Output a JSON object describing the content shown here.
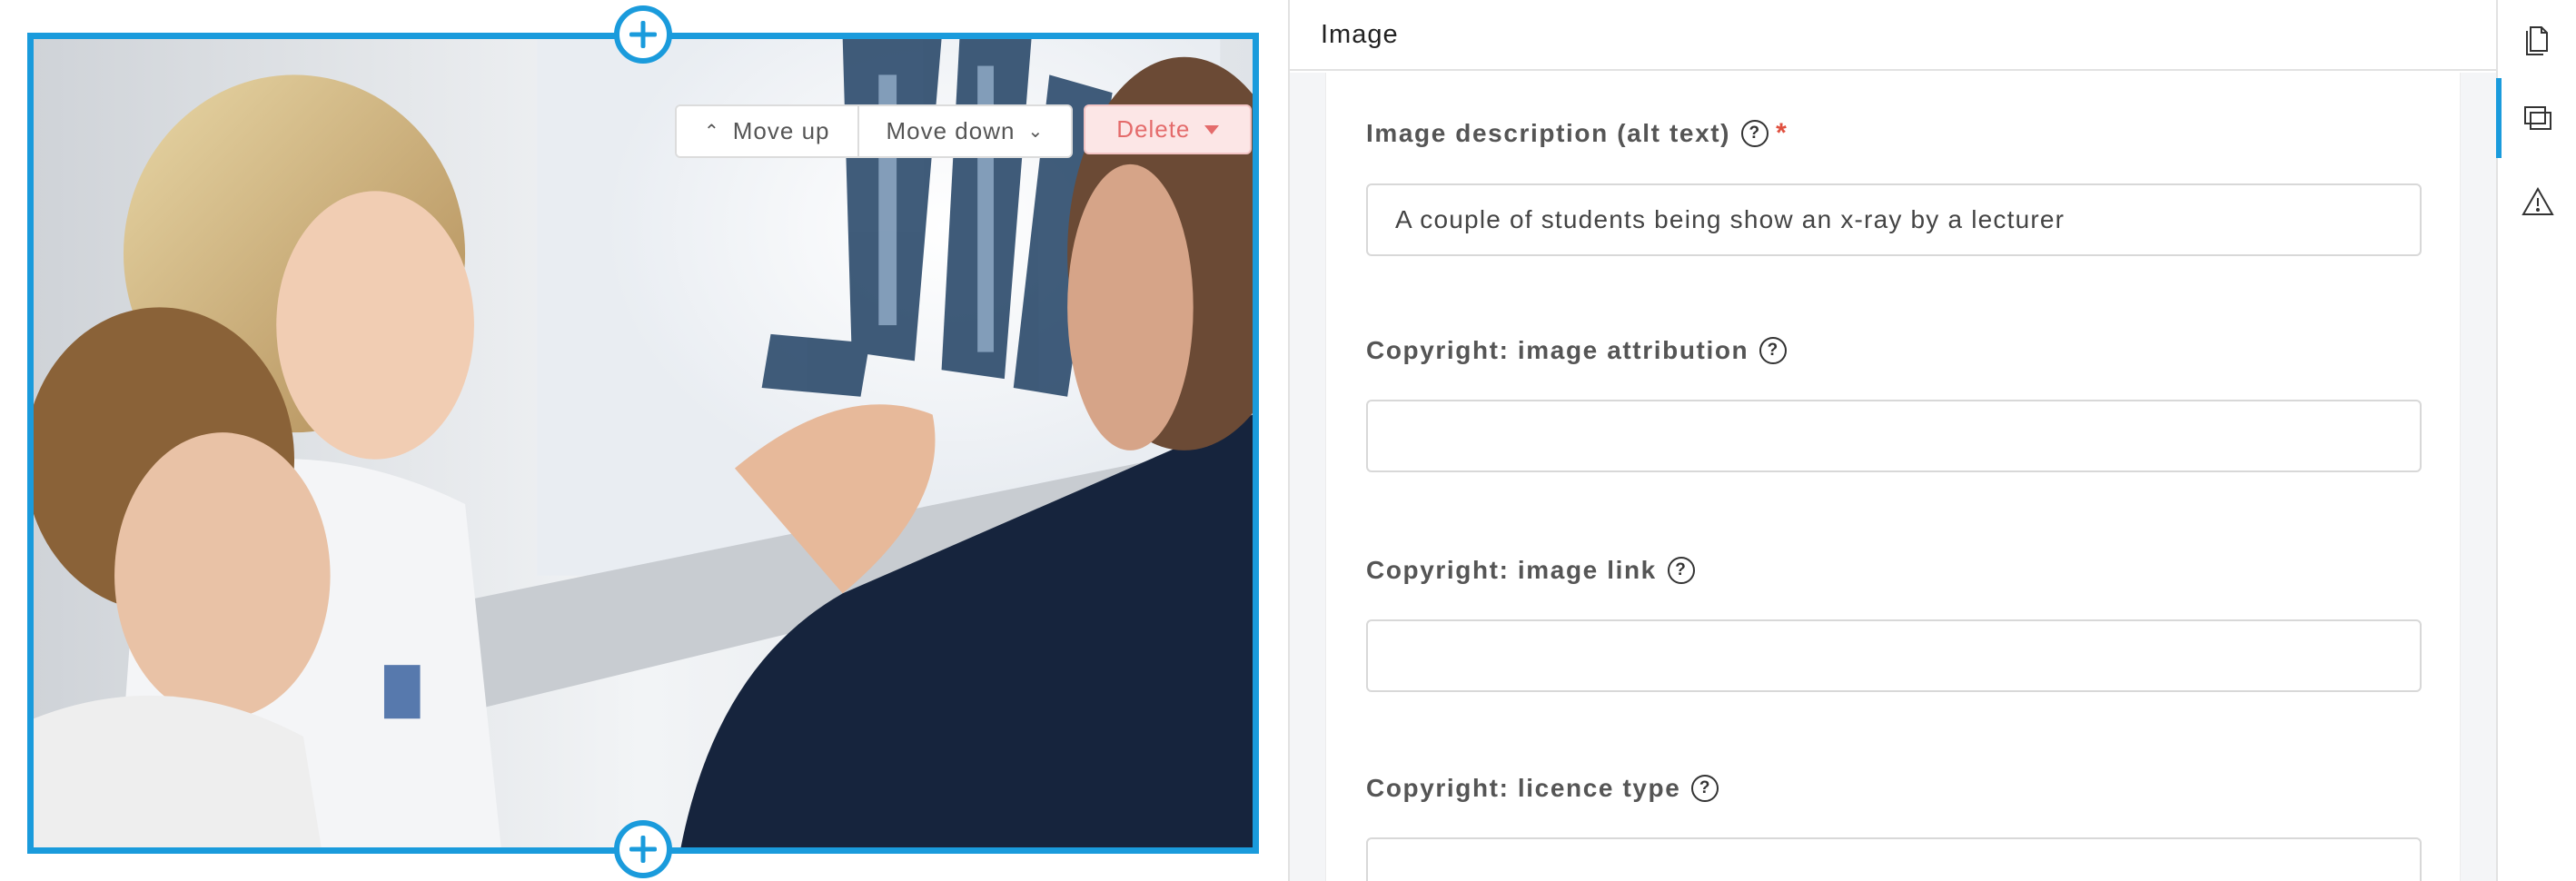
{
  "editor": {
    "toolbar": {
      "move_up": "Move up",
      "move_down": "Move down",
      "delete": "Delete"
    }
  },
  "panel": {
    "title": "Image",
    "fields": {
      "alt": {
        "label": "Image description (alt text)",
        "value": "A couple of students being show an x-ray by a  lecturer",
        "required": true
      },
      "attribution": {
        "label": "Copyright: image attribution",
        "value": ""
      },
      "link": {
        "label": "Copyright: image link",
        "value": ""
      },
      "licence": {
        "label": "Copyright: licence type",
        "value": ""
      }
    }
  },
  "rail": {
    "items": [
      "document-icon",
      "image-layers-icon",
      "warning-icon"
    ],
    "active": "image-layers-icon"
  },
  "colors": {
    "accent": "#1a9bdc",
    "delete_bg": "#fce6e6",
    "delete_text": "#e46b6b",
    "required": "#e0503f"
  }
}
